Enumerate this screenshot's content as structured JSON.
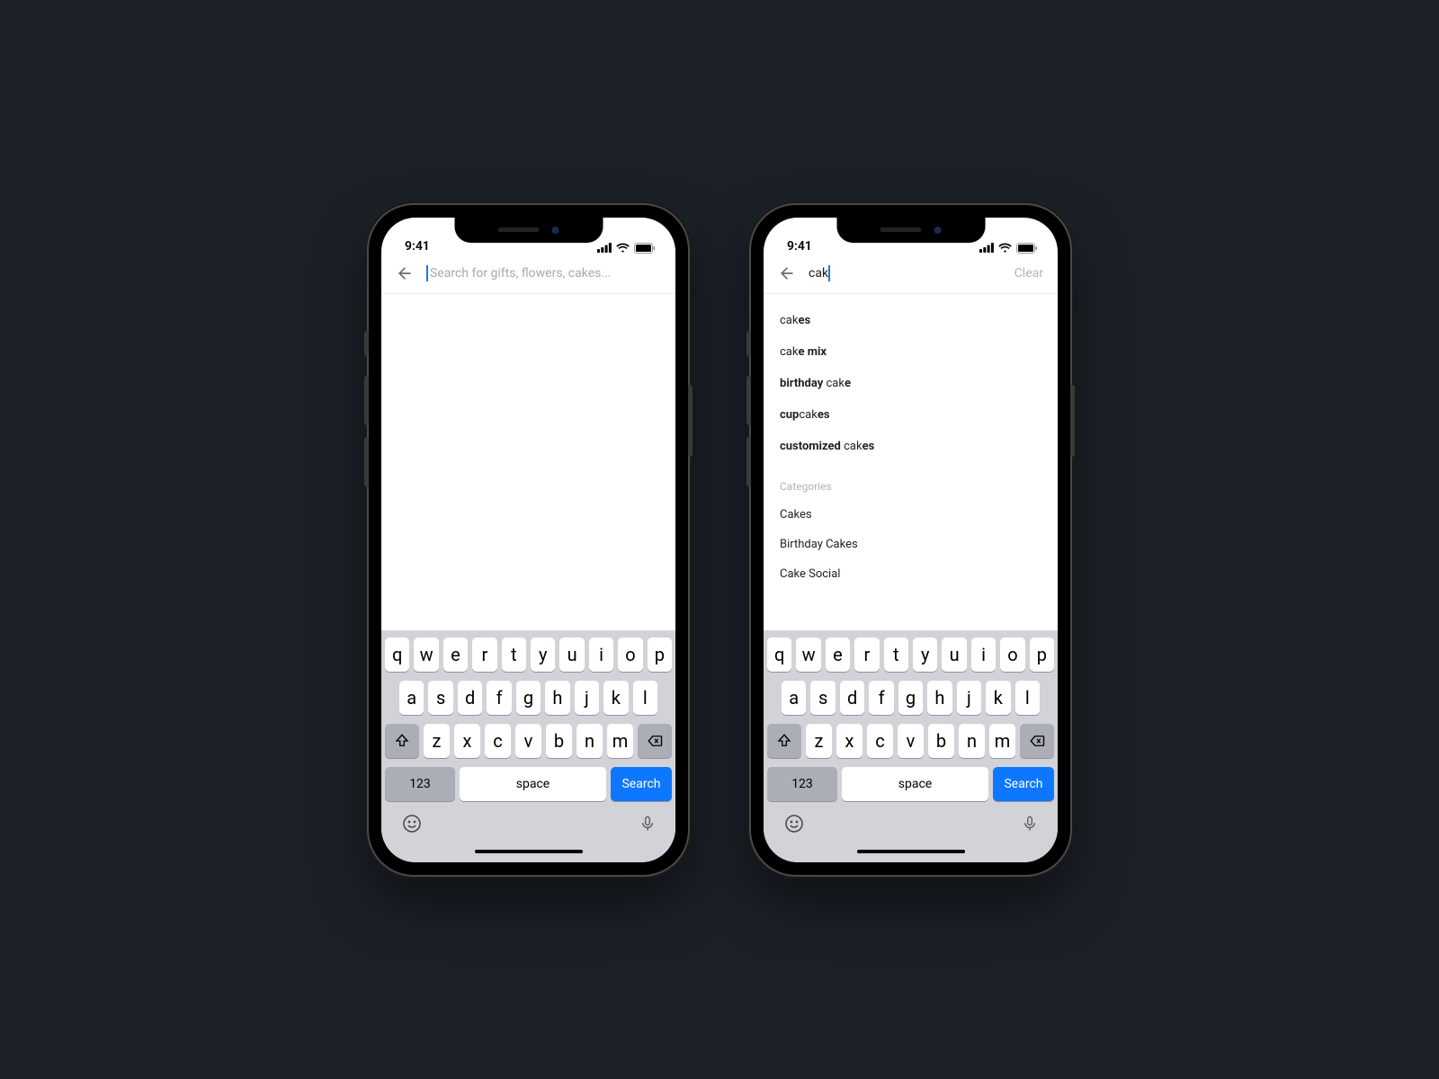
{
  "status": {
    "time": "9:41"
  },
  "search": {
    "placeholder": "Search for gifts, flowers, cakes...",
    "typed": "cak",
    "clear_label": "Clear"
  },
  "suggestions": [
    {
      "pre": "",
      "match": "cak",
      "post": "es"
    },
    {
      "pre": "",
      "match": "cak",
      "post": "e mix"
    },
    {
      "pre": "birthday ",
      "match": "cak",
      "post": "e"
    },
    {
      "pre": "cup",
      "match": "cak",
      "post": "es"
    },
    {
      "pre": "customized ",
      "match": "cak",
      "post": "es"
    }
  ],
  "categories_label": "Categories",
  "categories": [
    "Cakes",
    "Birthday Cakes",
    "Cake Social"
  ],
  "keyboard": {
    "row1": [
      "q",
      "w",
      "e",
      "r",
      "t",
      "y",
      "u",
      "i",
      "o",
      "p"
    ],
    "row2": [
      "a",
      "s",
      "d",
      "f",
      "g",
      "h",
      "j",
      "k",
      "l"
    ],
    "row3": [
      "z",
      "x",
      "c",
      "v",
      "b",
      "n",
      "m"
    ],
    "num": "123",
    "space": "space",
    "action": "Search"
  }
}
